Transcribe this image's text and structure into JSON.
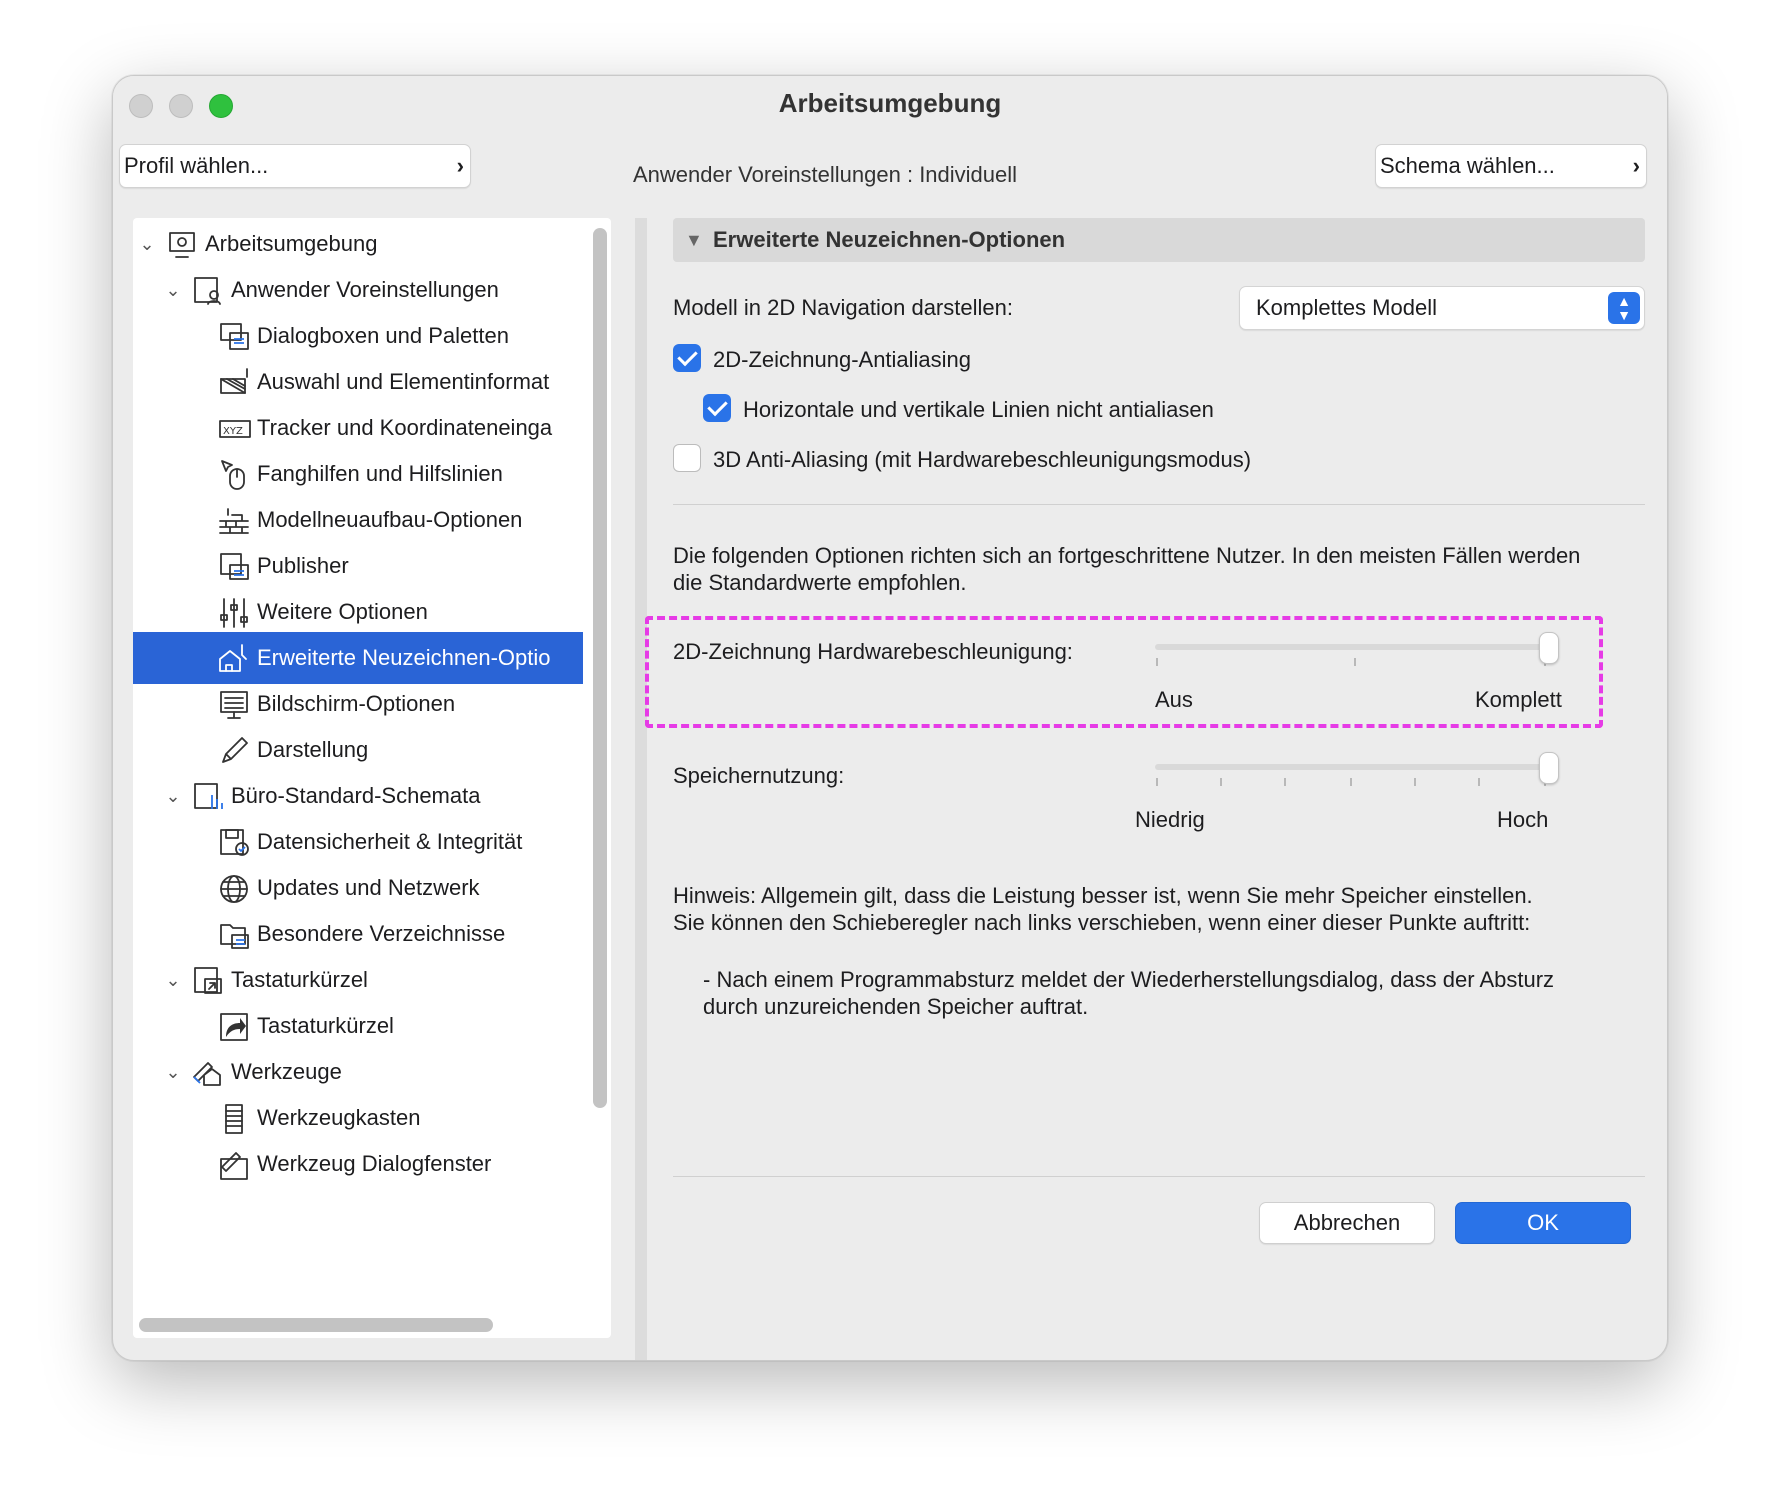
{
  "window": {
    "title": "Arbeitsumgebung"
  },
  "top": {
    "profile_button": "Profil wählen...",
    "user_prefs_label": "Anwender Voreinstellungen : Individuell",
    "schema_button": "Schema wählen..."
  },
  "sidebar": {
    "items": [
      {
        "label": "Arbeitsumgebung",
        "icon": "workspace-icon",
        "level": 0,
        "expanded": true
      },
      {
        "label": "Anwender Voreinstellungen",
        "icon": "user-prefs-icon",
        "level": 1,
        "expanded": true
      },
      {
        "label": "Dialogboxen und Paletten",
        "icon": "dialogs-icon",
        "level": 2
      },
      {
        "label": "Auswahl und Elementinformat",
        "icon": "selection-info-icon",
        "level": 2
      },
      {
        "label": "Tracker und Koordinateneinga",
        "icon": "xyz-icon",
        "level": 2
      },
      {
        "label": "Fanghilfen und Hilfslinien",
        "icon": "mouse-icon",
        "level": 2
      },
      {
        "label": "Modellneuaufbau-Optionen",
        "icon": "bricks-icon",
        "level": 2
      },
      {
        "label": "Publisher",
        "icon": "publisher-icon",
        "level": 2
      },
      {
        "label": "Weitere Optionen",
        "icon": "sliders-icon",
        "level": 2
      },
      {
        "label": "Erweiterte Neuzeichnen-Optio",
        "icon": "redraw-icon",
        "level": 2,
        "selected": true
      },
      {
        "label": "Bildschirm-Optionen",
        "icon": "screen-icon",
        "level": 2
      },
      {
        "label": "Darstellung",
        "icon": "pencil-icon",
        "level": 2
      },
      {
        "label": "Büro-Standard-Schemata",
        "icon": "office-schema-icon",
        "level": 1,
        "expanded": true
      },
      {
        "label": "Datensicherheit & Integrität",
        "icon": "save-check-icon",
        "level": 2
      },
      {
        "label": "Updates und Netzwerk",
        "icon": "globe-icon",
        "level": 2
      },
      {
        "label": "Besondere Verzeichnisse",
        "icon": "folder-icon",
        "level": 2
      },
      {
        "label": "Tastaturkürzel",
        "icon": "keyboard-shortcut-icon",
        "level": 1,
        "expanded": true
      },
      {
        "label": "Tastaturkürzel",
        "icon": "shortcut-arrow-icon",
        "level": 2
      },
      {
        "label": "Werkzeuge",
        "icon": "tools-icon",
        "level": 1,
        "expanded": true
      },
      {
        "label": "Werkzeugkasten",
        "icon": "toolbox-icon",
        "level": 2
      },
      {
        "label": "Werkzeug Dialogfenster",
        "icon": "tool-dialog-icon",
        "level": 2
      }
    ]
  },
  "main": {
    "section_title": "Erweiterte Neuzeichnen-Optionen",
    "model_nav_label": "Modell in 2D Navigation darstellen:",
    "model_nav_value": "Komplettes Modell",
    "checkboxes": [
      {
        "label": "2D-Zeichnung-Antialiasing",
        "checked": true
      },
      {
        "label": "Horizontale und vertikale Linien nicht antialiasen",
        "checked": true
      },
      {
        "label": "3D Anti-Aliasing (mit Hardwarebeschleunigungsmodus)",
        "checked": false
      }
    ],
    "advanced_note": "Die folgenden Optionen richten sich an fortgeschrittene Nutzer. In den meisten Fällen werden die Standardwerte empfohlen.",
    "hw_accel": {
      "label": "2D-Zeichnung Hardwarebeschleunigung:",
      "min_label": "Aus",
      "max_label": "Komplett",
      "value": 1.0,
      "ticks": 3
    },
    "memory": {
      "label": "Speichernutzung:",
      "min_label": "Niedrig",
      "max_label": "Hoch",
      "value": 1.0,
      "ticks": 7
    },
    "hint_1": "Hinweis: Allgemein gilt, dass die Leistung besser ist, wenn Sie mehr Speicher einstellen.",
    "hint_2": "Sie können den Schieberegler nach links verschieben, wenn einer dieser Punkte auftritt:",
    "bullet_1": "- Nach einem Programmabsturz meldet der Wiederherstellungsdialog, dass der Absturz",
    "bullet_2": "durch unzureichenden Speicher auftrat."
  },
  "footer": {
    "cancel": "Abbrechen",
    "ok": "OK"
  },
  "colors": {
    "accent": "#2a73e8",
    "selection": "#2a64d6",
    "highlight": "#e63be6"
  }
}
